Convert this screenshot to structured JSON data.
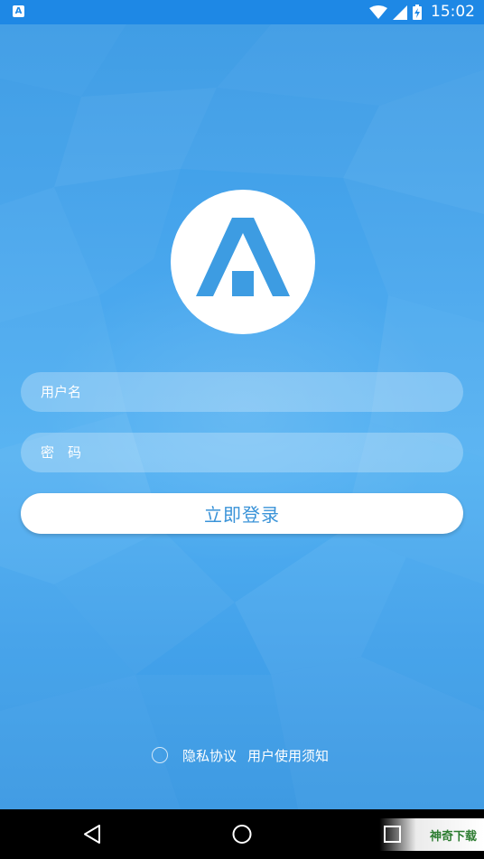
{
  "status_bar": {
    "app_icon": "A",
    "time": "15:02",
    "icons": [
      "wifi-icon",
      "signal-icon",
      "battery-charging-icon"
    ]
  },
  "logo": {
    "icon": "app-logo-A-icon"
  },
  "form": {
    "username_placeholder": "用户名",
    "password_placeholder": "密　码",
    "login_label": "立即登录"
  },
  "agreement": {
    "privacy_label": "隐私协议",
    "terms_label": "用户使用须知"
  },
  "nav_bar": {
    "buttons": [
      "back-icon",
      "home-icon",
      "recent-apps-icon"
    ]
  },
  "watermark": {
    "text": "神奇下载"
  },
  "colors": {
    "primary": "#1e88e5",
    "background": "#3d9de6",
    "button_text": "#3a93d8"
  }
}
